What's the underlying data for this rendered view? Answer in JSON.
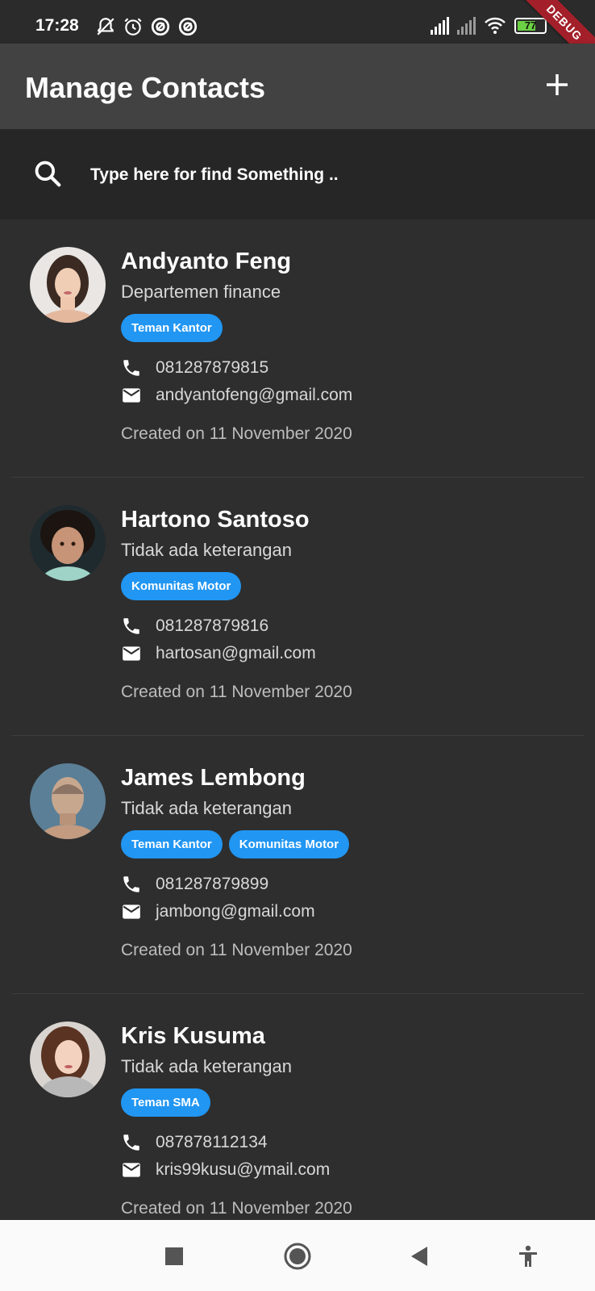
{
  "status": {
    "time": "17:28",
    "battery": "77",
    "debug_label": "DEBUG"
  },
  "app_bar": {
    "title": "Manage Contacts"
  },
  "search": {
    "placeholder": "Type here for find Something .."
  },
  "contacts": [
    {
      "name": "Andyanto Feng",
      "description": "Departemen finance",
      "tags": [
        "Teman Kantor"
      ],
      "phone": "081287879815",
      "email": "andyantofeng@gmail.com",
      "created": "Created on 11 November 2020"
    },
    {
      "name": "Hartono Santoso",
      "description": "Tidak ada keterangan",
      "tags": [
        "Komunitas Motor"
      ],
      "phone": "081287879816",
      "email": "hartosan@gmail.com",
      "created": "Created on 11 November 2020"
    },
    {
      "name": "James Lembong",
      "description": "Tidak ada keterangan",
      "tags": [
        "Teman Kantor",
        "Komunitas Motor"
      ],
      "phone": "081287879899",
      "email": "jambong@gmail.com",
      "created": "Created on 11 November 2020"
    },
    {
      "name": "Kris Kusuma",
      "description": "Tidak ada keterangan",
      "tags": [
        "Teman SMA"
      ],
      "phone": "087878112134",
      "email": "kris99kusu@ymail.com",
      "created": "Created on 11 November 2020"
    }
  ],
  "colors": {
    "accent": "#2196f3",
    "app_bar": "#424242",
    "background": "#2e2e2e"
  }
}
